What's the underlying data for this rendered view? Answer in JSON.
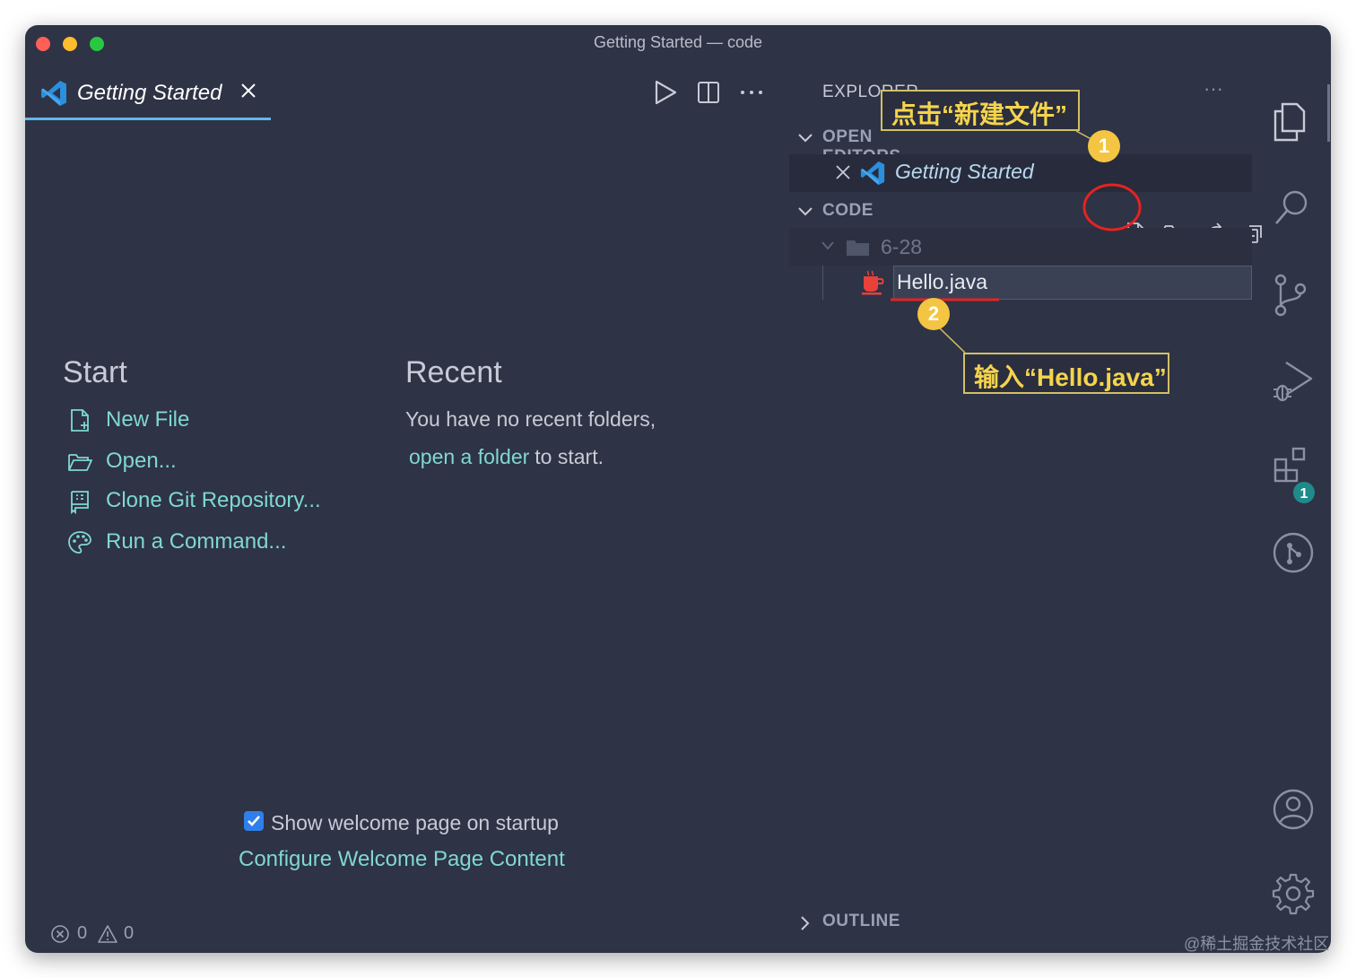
{
  "window": {
    "title": "Getting Started — code"
  },
  "editor": {
    "tab": {
      "label": "Getting Started",
      "icon": "vscode-logo-icon"
    },
    "actions": [
      "run-icon",
      "split-editor-icon",
      "more-icon"
    ]
  },
  "welcome": {
    "start": {
      "heading": "Start",
      "items": [
        {
          "label": "New File",
          "icon": "new-file-icon"
        },
        {
          "label": "Open...",
          "icon": "folder-open-icon"
        },
        {
          "label": "Clone Git Repository...",
          "icon": "git-repo-icon"
        },
        {
          "label": "Run a Command...",
          "icon": "palette-icon"
        }
      ]
    },
    "recent": {
      "heading": "Recent",
      "line1": "You have no recent folders,",
      "link": "open a folder",
      "line2_suffix": "to start."
    },
    "startup_checkbox_label": "Show welcome page on startup",
    "configure_link": "Configure Welcome Page Content"
  },
  "status_bar": {
    "errors": "0",
    "warnings": "0"
  },
  "explorer": {
    "title": "EXPLORER",
    "more": "···",
    "open_editors": {
      "header": "OPEN EDITORS",
      "items": [
        {
          "label": "Getting Started"
        }
      ]
    },
    "workspace": {
      "header": "CODE",
      "actions": [
        "new-file-icon",
        "new-folder-icon",
        "refresh-icon",
        "collapse-all-icon"
      ],
      "folder": "6-28",
      "new_file_input": "Hello.java"
    },
    "outline": {
      "header": "OUTLINE"
    }
  },
  "activity_bar": {
    "items": [
      "explorer-icon",
      "search-icon",
      "source-control-icon",
      "run-debug-icon",
      "extensions-icon",
      "git-graph-icon"
    ],
    "extensions_badge": "1",
    "bottom": [
      "account-icon",
      "settings-gear-icon"
    ]
  },
  "annotations": {
    "callout_1": "点击“新建文件”",
    "badge_1": "1",
    "callout_2": "输入“Hello.java”",
    "badge_2": "2",
    "highlight_color": "#e52320",
    "callout_color": "#f5d44c"
  },
  "watermark": "@稀土掘金技术社区"
}
